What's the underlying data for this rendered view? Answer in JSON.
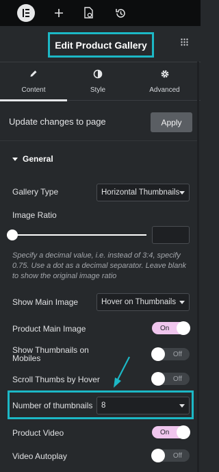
{
  "topbar": {
    "logo_icon": "elementor-logo-icon",
    "add_icon": "plus-icon",
    "page_settings_icon": "page-settings-icon",
    "history_icon": "history-icon"
  },
  "header": {
    "title": "Edit Product Gallery",
    "grid_icon": "grid-icon",
    "highlight_color": "#1cb8c6"
  },
  "tabs": [
    {
      "label": "Content",
      "icon": "pencil-icon",
      "active": true
    },
    {
      "label": "Style",
      "icon": "contrast-icon",
      "active": false
    },
    {
      "label": "Advanced",
      "icon": "gear-icon",
      "active": false
    }
  ],
  "update": {
    "text": "Update changes to page",
    "button": "Apply"
  },
  "section": {
    "title": "General"
  },
  "fields": {
    "gallery_type": {
      "label": "Gallery Type",
      "value": "Horizontal Thumbnails"
    },
    "image_ratio": {
      "label": "Image Ratio",
      "value": "",
      "slider_fraction": 0,
      "help": "Specify a decimal value, i.e. instead of 3:4, specify 0.75. Use a dot as a decimal separator. Leave blank to show the original image ratio"
    },
    "show_main_image": {
      "label": "Show Main Image",
      "value": "Hover on Thumbnails"
    },
    "product_main_image": {
      "label": "Product Main Image",
      "toggle": "On"
    },
    "show_thumbnails_mobiles": {
      "label": "Show Thumbnails on Mobiles",
      "toggle": "Off"
    },
    "scroll_thumbs_hover": {
      "label": "Scroll Thumbs by Hover",
      "toggle": "Off"
    },
    "number_of_thumbnails": {
      "label": "Number of thumbnails",
      "value": "8"
    },
    "product_video": {
      "label": "Product Video",
      "toggle": "On"
    },
    "video_autoplay": {
      "label": "Video Autoplay",
      "toggle": "Off"
    }
  }
}
